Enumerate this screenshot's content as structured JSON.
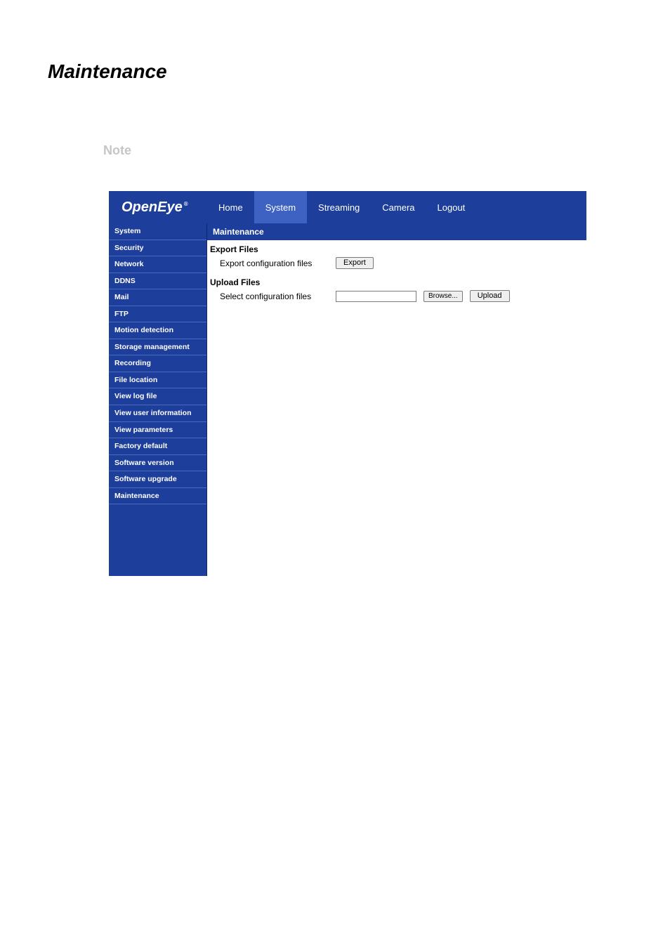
{
  "page": {
    "title": "Maintenance",
    "note_heading": "Note"
  },
  "header": {
    "logo": "OpenEye",
    "nav": [
      {
        "label": "Home"
      },
      {
        "label": "System"
      },
      {
        "label": "Streaming"
      },
      {
        "label": "Camera"
      },
      {
        "label": "Logout"
      }
    ],
    "active_index": 1
  },
  "sidebar": {
    "items": [
      {
        "label": "System"
      },
      {
        "label": "Security"
      },
      {
        "label": "Network"
      },
      {
        "label": "DDNS"
      },
      {
        "label": "Mail"
      },
      {
        "label": "FTP"
      },
      {
        "label": "Motion detection"
      },
      {
        "label": "Storage management"
      },
      {
        "label": "Recording"
      },
      {
        "label": "File location"
      },
      {
        "label": "View log file"
      },
      {
        "label": "View user information"
      },
      {
        "label": "View parameters"
      },
      {
        "label": "Factory default"
      },
      {
        "label": "Software version"
      },
      {
        "label": "Software upgrade"
      },
      {
        "label": "Maintenance"
      }
    ]
  },
  "content": {
    "title": "Maintenance",
    "export": {
      "heading": "Export Files",
      "label": "Export configuration files",
      "button": "Export"
    },
    "upload": {
      "heading": "Upload Files",
      "label": "Select configuration files",
      "file_value": "",
      "browse_button": "Browse...",
      "upload_button": "Upload"
    }
  }
}
